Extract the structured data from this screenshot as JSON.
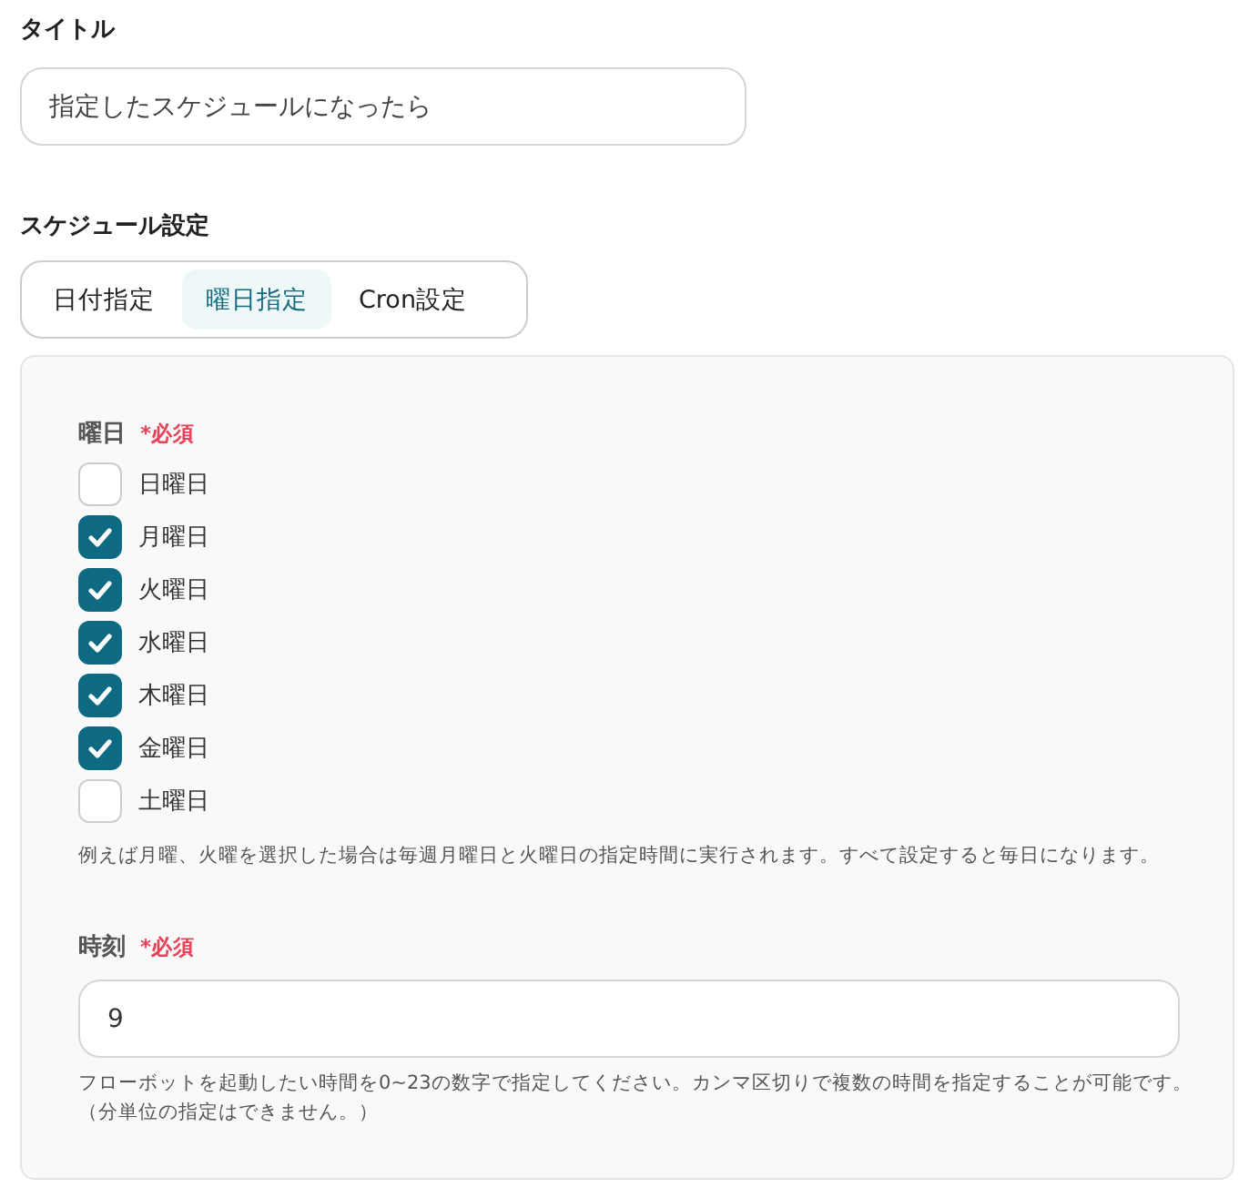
{
  "title_field": {
    "label": "タイトル",
    "value": "指定したスケジュールになったら"
  },
  "schedule": {
    "label": "スケジュール設定",
    "tabs": [
      {
        "label": "日付指定",
        "selected": false
      },
      {
        "label": "曜日指定",
        "selected": true
      },
      {
        "label": "Cron設定",
        "selected": false
      }
    ],
    "weekdays": {
      "label": "曜日",
      "required": "*必須",
      "options": [
        {
          "label": "日曜日",
          "checked": false
        },
        {
          "label": "月曜日",
          "checked": true
        },
        {
          "label": "火曜日",
          "checked": true
        },
        {
          "label": "水曜日",
          "checked": true
        },
        {
          "label": "木曜日",
          "checked": true
        },
        {
          "label": "金曜日",
          "checked": true
        },
        {
          "label": "土曜日",
          "checked": false
        }
      ],
      "help": [
        "例えば月曜、火曜を選択した場合は毎週月曜日と火曜日の指定時間に実行されます。すべて設定すると毎日になります。"
      ]
    },
    "time": {
      "label": "時刻",
      "required": "*必須",
      "value": "9",
      "help": [
        "フローボットを起動したい時間を0~23の数字で指定してください。カンマ区切りで複数の時間を指定することが可能です。",
        "（分単位の指定はできません。）"
      ]
    }
  }
}
